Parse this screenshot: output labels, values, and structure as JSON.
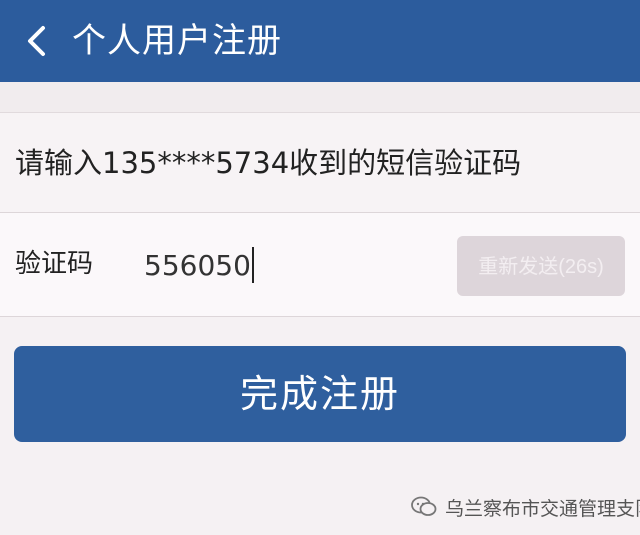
{
  "header": {
    "title": "个人用户注册"
  },
  "prompt": {
    "text": "请输入135****5734收到的短信验证码"
  },
  "verification": {
    "label": "验证码",
    "value": "556050",
    "resend_label": "重新发送(26s)"
  },
  "actions": {
    "submit_label": "完成注册"
  },
  "watermark": {
    "text": "乌兰察布市交通管理支队"
  },
  "colors": {
    "accent": "#2c5c9d",
    "button": "#2f5f9e",
    "resend_disabled": "#ddd5da",
    "background": "#f5f1f3"
  },
  "icons": {
    "back": "chevron-left-icon",
    "watermark": "wechat-icon"
  }
}
